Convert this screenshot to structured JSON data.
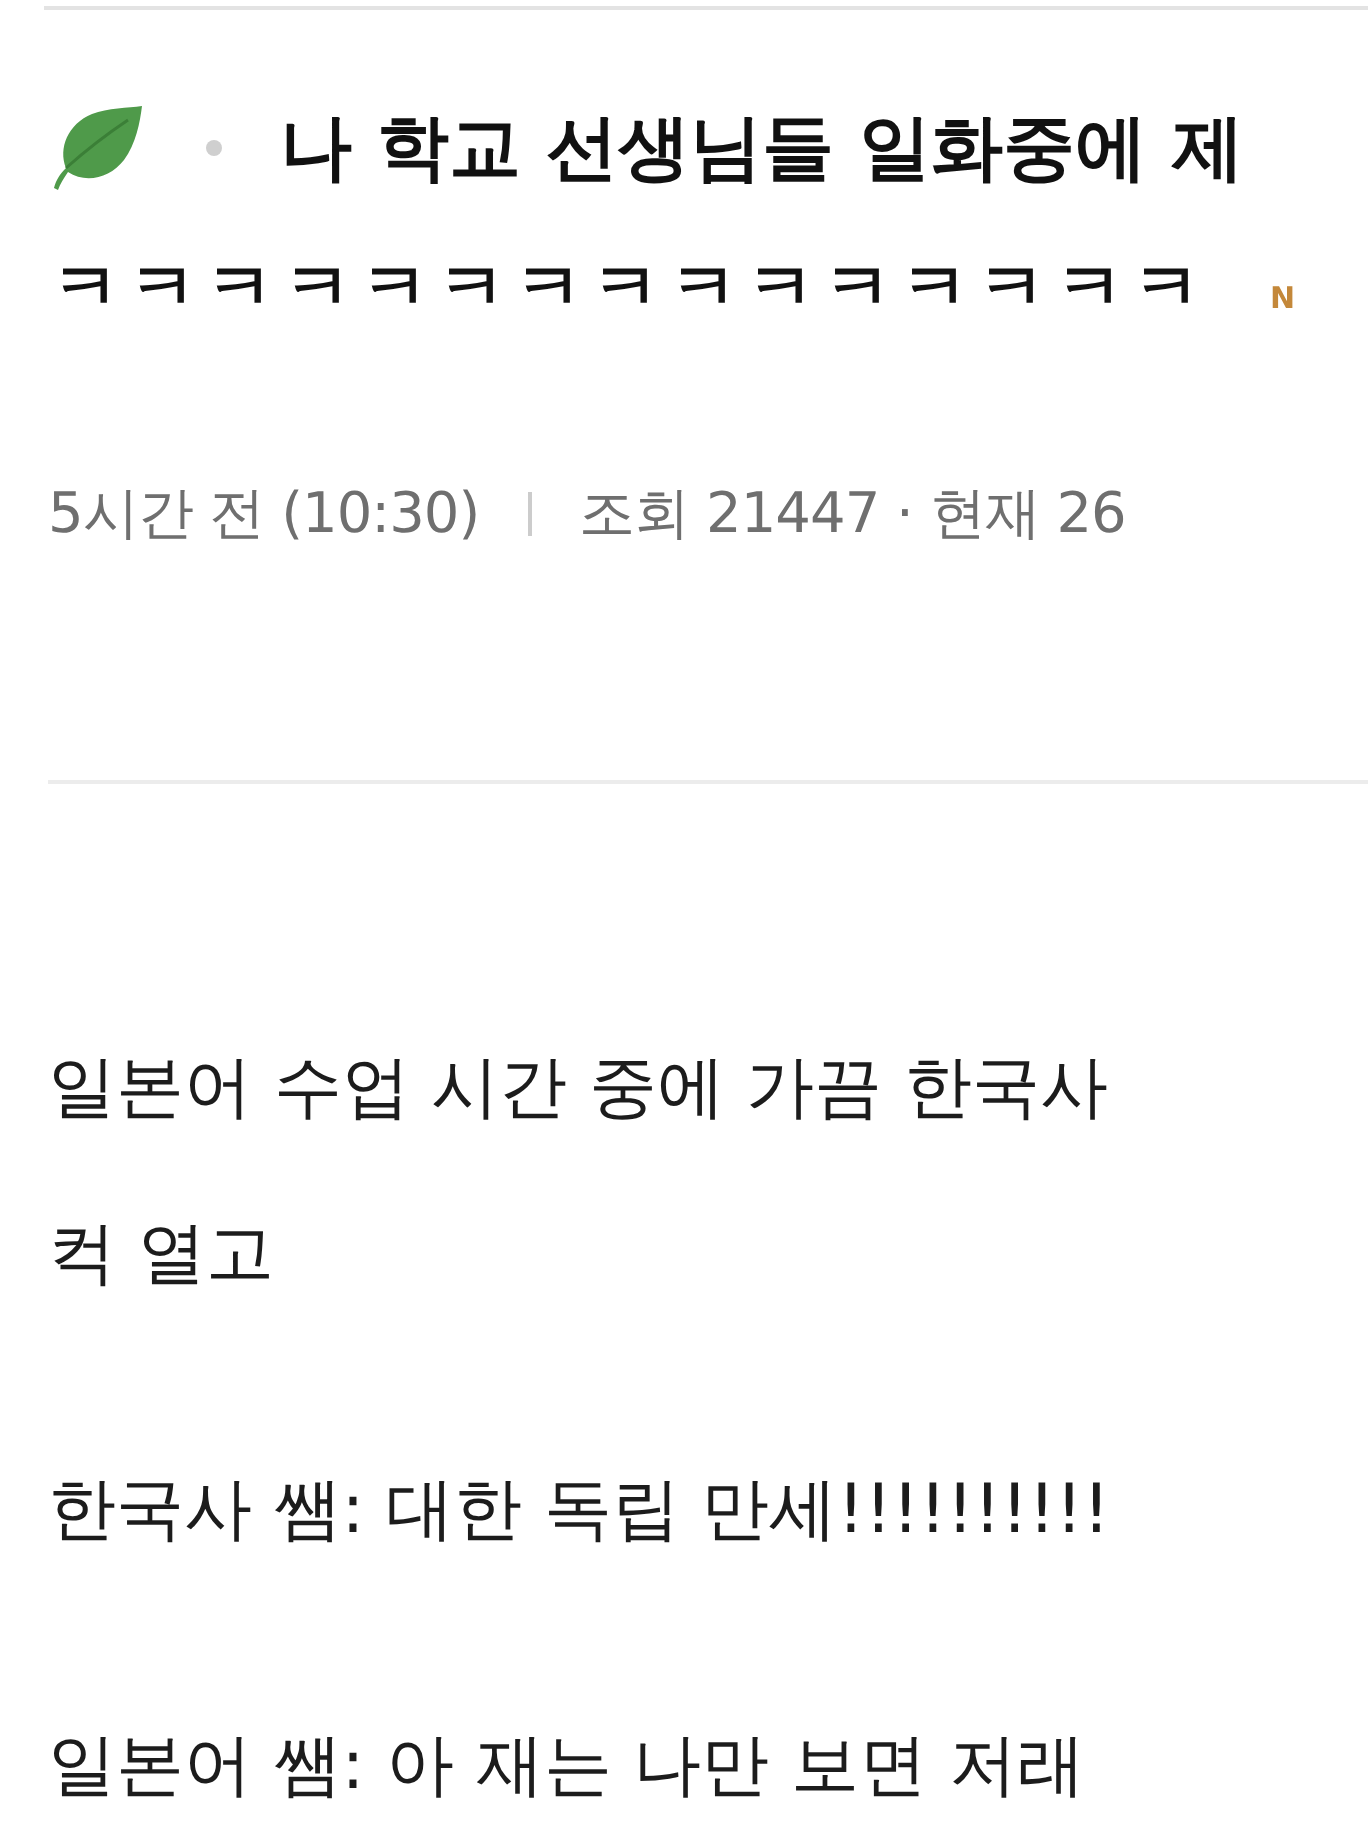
{
  "post": {
    "title_lines": [
      "나 학교 선생님들 일화중에 제",
      "ㅋㅋㅋㅋㅋㅋㅋㅋㅋㅋㅋㅋㅋㅋㅋ"
    ],
    "new_label": "N",
    "time": "5시간 전 (10:30)",
    "stats": "조회 21447 · 현재 26"
  },
  "body": {
    "paragraphs": [
      {
        "lines": [
          "일본어 수업 시간 중에 가끔 한국사",
          "컥 열고"
        ]
      },
      {
        "lines": [
          "한국사 쌤: 대한 독립 만세!!!!!!!!!!"
        ]
      },
      {
        "lines": [
          "일본어 쌤: 아 재는 나만 보면 저래"
        ]
      }
    ]
  }
}
